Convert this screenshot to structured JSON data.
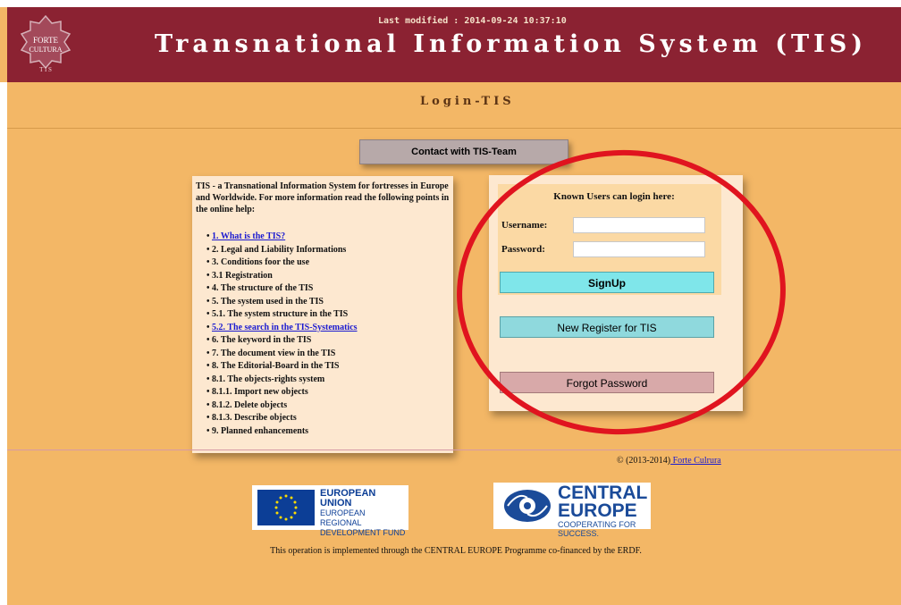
{
  "header": {
    "last_modified": "Last modified : 2014-09-24 10:37:10",
    "title": "Transnational Information System (TIS)",
    "logo_text": "FORTE CULTURA TIS"
  },
  "subtitle": "Login-TIS",
  "contact_button": "Contact with TIS-Team",
  "help": {
    "intro": "TIS - a Transnational Information System for fortresses in Europe and Worldwide. For more information read the following points in the online help:",
    "items": [
      {
        "label": "1. What is the TIS?",
        "link": true
      },
      {
        "label": "2. Legal and Liability Informations",
        "link": false
      },
      {
        "label": "3. Conditions foor the use",
        "link": false
      },
      {
        "label": "3.1 Registration",
        "link": false
      },
      {
        "label": "4. The structure of the TIS",
        "link": false
      },
      {
        "label": "5. The system used in the TIS",
        "link": false
      },
      {
        "label": "5.1. The system structure in the TIS",
        "link": false
      },
      {
        "label": "5.2. The search in the TIS-Systematics",
        "link": true
      },
      {
        "label": "6. The keyword in the TIS",
        "link": false
      },
      {
        "label": "7. The document view in the TIS",
        "link": false
      },
      {
        "label": "8. The Editorial-Board in the TIS",
        "link": false
      },
      {
        "label": "8.1. The objects-rights system",
        "link": false
      },
      {
        "label": "8.1.1. Import new objects",
        "link": false
      },
      {
        "label": "8.1.2. Delete objects",
        "link": false
      },
      {
        "label": "8.1.3. Describe objects",
        "link": false
      },
      {
        "label": "9. Planned enhancements",
        "link": false
      }
    ]
  },
  "login": {
    "heading": "Known Users can login here:",
    "username_label": "Username:",
    "username_value": "",
    "password_label": "Password:",
    "password_value": "",
    "signup": "SignUp",
    "new_register": "New Register for TIS",
    "forgot_password": "Forgot Password"
  },
  "footer": {
    "copyright_prefix": "© (2013-2014)",
    "copyright_link": " Forte Culrura",
    "eu_line1": "EUROPEAN UNION",
    "eu_line2": "EUROPEAN REGIONAL",
    "eu_line3": "DEVELOPMENT FUND",
    "ce_line1": "CENTRAL",
    "ce_line2": "EUROPE",
    "ce_line3": "COOPERATING FOR SUCCESS.",
    "note": "This operation is implemented through the CENTRAL EUROPE Programme co-financed by the ERDF."
  },
  "colors": {
    "header_bg": "#8b2232",
    "page_bg": "#f3b766",
    "annotation_ellipse": "#e0141f"
  }
}
